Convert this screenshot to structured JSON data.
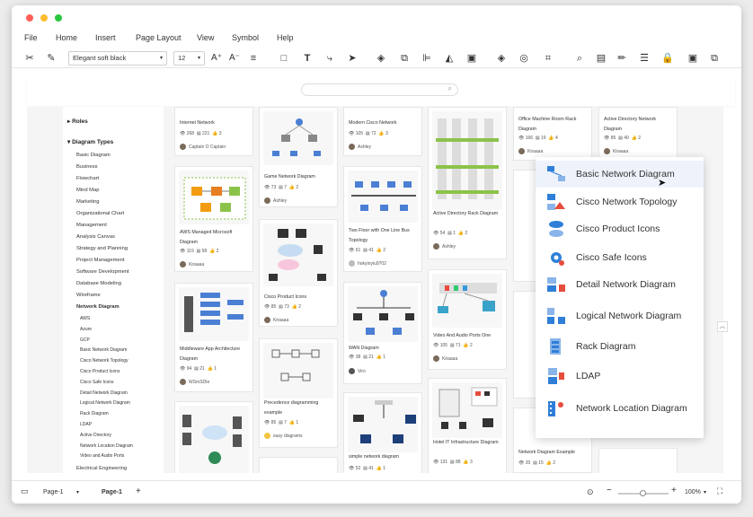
{
  "menus": [
    "File",
    "Home",
    "Insert",
    "Page Layout",
    "View",
    "Symbol",
    "Help"
  ],
  "toolbar": {
    "font_family": "Elegant soft black",
    "font_size": "12"
  },
  "sidebar": {
    "roles_label": "Roles",
    "types_label": "Diagram Types",
    "items": [
      "Basic Diagram",
      "Business",
      "Flowchart",
      "Mind Map",
      "Marketing",
      "Organizational Chart",
      "Management",
      "Analysis Canvas",
      "Strategy and Planning",
      "Project Management",
      "Software Development",
      "Database Modeling",
      "Wireframe"
    ],
    "network_label": "Network Diagram",
    "sub_items": [
      "AWS",
      "Azure",
      "GCP",
      "Basic Network Diagram",
      "Cisco Network Topology",
      "Cisco Product Icons",
      "Cisco Safe Icons",
      "Detail Network Diagram",
      "Logical Network Diagram",
      "Rack Diagram",
      "LDAP",
      "Active Directory",
      "Network Location Diagram",
      "Video and Audio Ports"
    ],
    "bottom_item": "Electrical Engineering"
  },
  "cards": [
    {
      "title": "Internet Network",
      "views": "268",
      "likes": "221",
      "shares": "3",
      "author": "Captain O Captain"
    },
    {
      "title": "AWS Managed Microsoft Diagram",
      "views": "119",
      "likes": "58",
      "shares": "2",
      "author": "Kiraaaa"
    },
    {
      "title": "Middleware App Architecture Diagram",
      "views": "94",
      "likes": "21",
      "shares": "1",
      "author": "WSmSDIe"
    },
    {
      "title": "",
      "views": "",
      "likes": "",
      "shares": "",
      "author": ""
    },
    {
      "title": "Game Network Diagram",
      "views": "73",
      "likes": "7",
      "shares": "2",
      "author": "Ashley"
    },
    {
      "title": "Cisco Product Icons",
      "views": "85",
      "likes": "73",
      "shares": "2",
      "author": "Kiraaaa"
    },
    {
      "title": "Precedence diagramming example",
      "views": "85",
      "likes": "7",
      "shares": "1",
      "author": "easy diagrams"
    },
    {
      "title": "Modern Cisco Network",
      "views": "105",
      "likes": "72",
      "shares": "3",
      "author": "Ashley"
    },
    {
      "title": "Two Floor with One Line Bus Topology",
      "views": "61",
      "likes": "41",
      "shares": "2",
      "author": "hokyinyiu9702"
    },
    {
      "title": "WAN Diagram",
      "views": "38",
      "likes": "21",
      "shares": "1",
      "author": "Viro"
    },
    {
      "title": "simple network diagram",
      "views": "52",
      "likes": "41",
      "shares": "1",
      "author": ""
    },
    {
      "title": "Active Directory Rack Diagram",
      "views": "54",
      "likes": "1",
      "shares": "2",
      "author": "Ashley"
    },
    {
      "title": "Video And Audio Ports One",
      "views": "105",
      "likes": "71",
      "shares": "2",
      "author": "Kiraaaa"
    },
    {
      "title": "Hotel IT Infrastructure Diagram",
      "views": "131",
      "likes": "88",
      "shares": "3",
      "author": ""
    },
    {
      "title": "Office Machine Room Rack Diagram",
      "views": "166",
      "likes": "19",
      "shares": "4",
      "author": "Kiraaaa"
    },
    {
      "title": "Active Directory Network Diagram",
      "views": "85",
      "likes": "40",
      "shares": "2",
      "author": "Kiraaaa"
    },
    {
      "title": "Network Diagram Example",
      "views": "20",
      "likes": "15",
      "shares": "2",
      "author": ""
    }
  ],
  "popup": [
    "Basic Network Diagram",
    "Cisco Network Topology",
    "Cisco Product Icons",
    "Cisco Safe Icons",
    "Detail Network Diagram",
    "Logical Network Diagram",
    "Rack Diagram",
    "LDAP",
    "Network Location Diagram"
  ],
  "status": {
    "page_tab": "Page-1",
    "page_tab_active": "Page-1",
    "add": "+",
    "zoom": "100%"
  },
  "colors": {
    "accent": "#2f7fd8",
    "traffic_red": "#ff5f57",
    "traffic_yellow": "#febc2e",
    "traffic_green": "#28c840"
  }
}
